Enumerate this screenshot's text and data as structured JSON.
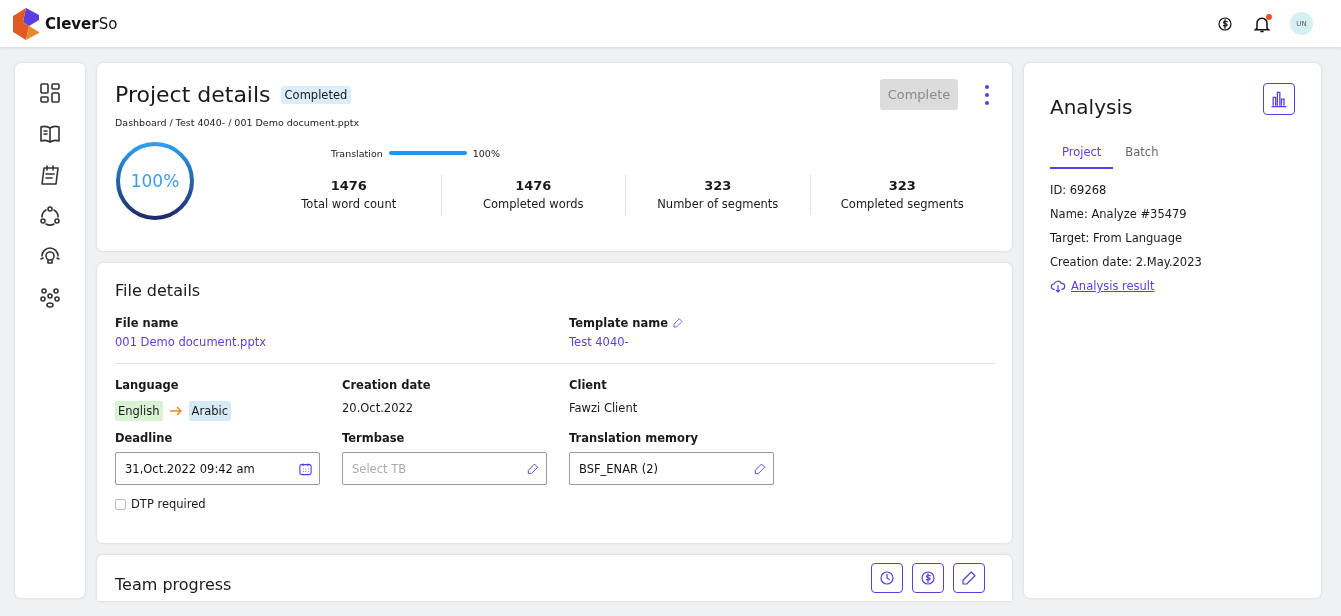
{
  "header": {
    "logo_text": "Clever",
    "logo_text_light": "So",
    "avatar_initials": "UN"
  },
  "project": {
    "title": "Project details",
    "status": "Completed",
    "breadcrumb": "Dashboard / Test 4040- / 001 Demo document.pptx",
    "complete_button": {
      "label": "Complete",
      "disabled": true
    },
    "overall": {
      "label": "100%",
      "level": 1
    },
    "translation": {
      "label": "Translation",
      "level": 1,
      "reading": "100%"
    },
    "stats": [
      {
        "value": "1476",
        "label": "Total word count"
      },
      {
        "value": "1476",
        "label": "Completed words"
      },
      {
        "value": "323",
        "label": "Number of segments"
      },
      {
        "value": "323",
        "label": "Completed segments"
      }
    ]
  },
  "file": {
    "title": "File details",
    "file_name_label": "File name",
    "file_name": "001 Demo document.pptx",
    "template_label": "Template name",
    "template": "Test 4040-",
    "language_label": "Language",
    "source_language": "English",
    "target_language": "Arabic",
    "creation_label": "Creation date",
    "creation_date": "20.Oct.2022",
    "client_label": "Client",
    "client": "Fawzi Client",
    "fields": [
      {
        "kind": "date",
        "label": "Deadline",
        "value": "31,Oct.2022 09:42 am"
      },
      {
        "kind": "edit",
        "label": "Termbase",
        "placeholder": "Select TB"
      },
      {
        "kind": "edit",
        "label": "Translation memory",
        "value": "BSF_ENAR (2)"
      }
    ],
    "dtp": {
      "label": "DTP required",
      "checked": false
    }
  },
  "team": {
    "title": "Team progress"
  },
  "analysis": {
    "title": "Analysis",
    "tabs": [
      {
        "label": "Project",
        "selected": true
      },
      {
        "label": "Batch",
        "selected": false
      }
    ],
    "lines": [
      {
        "key": "ID:",
        "value": "69268"
      },
      {
        "key": "Name:",
        "value": "Analyze #35479"
      },
      {
        "key": "Target:",
        "value": "From Language"
      },
      {
        "key": "Creation date:",
        "value": "2.May.2023"
      }
    ],
    "result_link": "Analysis result"
  }
}
